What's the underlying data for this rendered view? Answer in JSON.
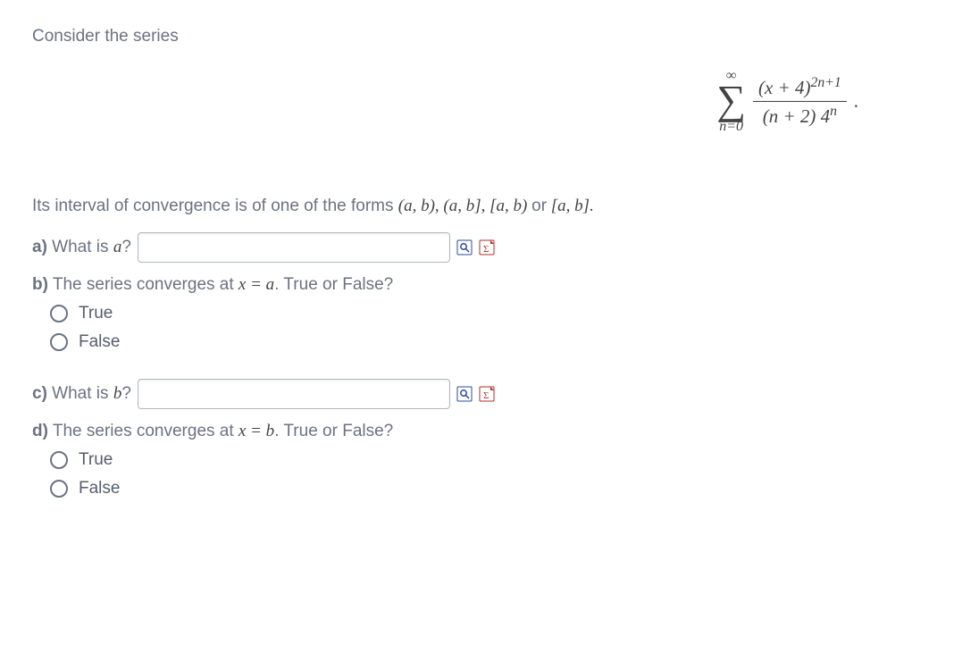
{
  "intro": "Consider the series",
  "formula": {
    "upper": "∞",
    "lower": "n=0",
    "numerator_a": "(x + 4)",
    "numerator_exp": "2n+1",
    "denom_a": "(n + 2) 4",
    "denom_exp": "n",
    "tail": "."
  },
  "interval_sentence_a": "Its interval of convergence is of one of the forms ",
  "interval_forms": "(a, b), (a, b], [a, b) ",
  "interval_or": "or",
  "interval_last": " [a, b].",
  "qa": {
    "label": "a)",
    "text": " What is ",
    "var": "a",
    "q": "?"
  },
  "qb": {
    "label": "b)",
    "text": " The series converges at ",
    "eq": "x = a",
    "tail": ". True or False?"
  },
  "qc": {
    "label": "c)",
    "text": " What is ",
    "var": "b",
    "q": "?"
  },
  "qd": {
    "label": "d)",
    "text": " The series converges at ",
    "eq": "x = b",
    "tail": ". True or False?"
  },
  "options": {
    "true": "True",
    "false": "False"
  }
}
